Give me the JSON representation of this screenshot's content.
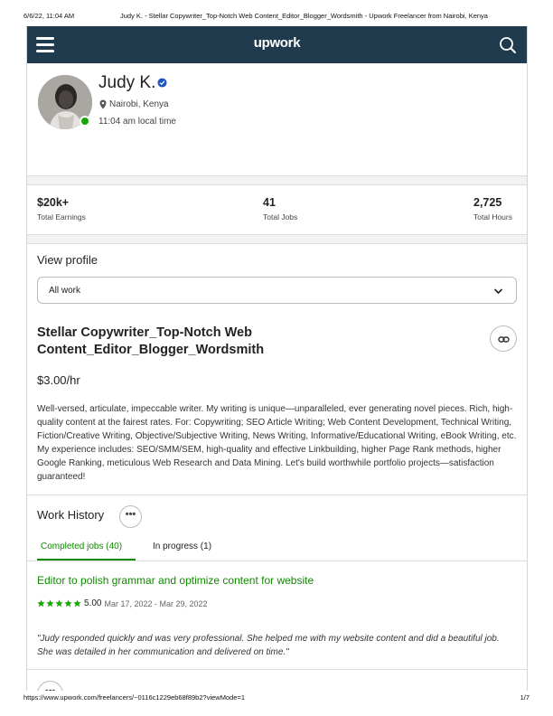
{
  "print_header": {
    "date": "6/6/22, 11:04 AM",
    "title": "Judy K. - Stellar Copywriter_Top-Notch Web Content_Editor_Blogger_Wordsmith - Upwork Freelancer from Nairobi, Kenya"
  },
  "print_footer": {
    "url": "https://www.upwork.com/freelancers/~0116c1229eb68f89b2?viewMode=1",
    "page": "1/7"
  },
  "topbar": {
    "logo": "upwork",
    "icons": [
      "hamburger-menu-icon",
      "search-icon"
    ],
    "background": "#1f3b4d"
  },
  "profile": {
    "name": "Judy K.",
    "location": "Nairobi, Kenya",
    "local_time": "11:04 am local time",
    "online": true
  },
  "stats": [
    {
      "value": "$20k+",
      "label": "Total Earnings"
    },
    {
      "value": "41",
      "label": "Total Jobs"
    },
    {
      "value": "2,725",
      "label": "Total Hours"
    }
  ],
  "main": {
    "view_profile_label": "View profile",
    "work_filter_selected": "All work",
    "headline": "Stellar Copywriter_Top-Notch Web Content_Editor_Blogger_Wordsmith",
    "rate": "$3.00/hr",
    "overview": "Well-versed, articulate, impeccable writer. My writing is unique—unparalleled, ever generating novel pieces. Rich, high-quality content at the fairest rates. For: Copywriting; SEO Article Writing; Web Content Development, Technical Writing, Fiction/Creative Writing, Objective/Subjective Writing, News Writing, Informative/Educational Writing, eBook Writing, etc. My experience includes: SEO/SMM/SEM, high-quality and effective Linkbuilding, higher Page Rank methods, higher Google Ranking, meticulous Web Research and Data Mining. Let's build worthwhile portfolio projects—satisfaction guaranteed!"
  },
  "work_history": {
    "title": "Work History",
    "more_label": "•••",
    "tabs": [
      {
        "label": "Completed jobs (40)",
        "active": true
      },
      {
        "label": "In progress (1)",
        "active": false
      }
    ],
    "job": {
      "title": "Editor to polish grammar and optimize content for website",
      "rating": 5.0,
      "rating_label": "5.00",
      "dates": "Mar 17, 2022 - Mar 29, 2022",
      "feedback": "\"Judy responded quickly and was very professional. She helped me with my website content and did a beautiful job. She was detailed in her communication and delivered on time.\""
    }
  },
  "bottom_bar": {
    "more_label": "•••"
  },
  "colors": {
    "accent_green": "#108a00",
    "online_green": "#14a800",
    "verified_blue": "#1f57c3"
  }
}
